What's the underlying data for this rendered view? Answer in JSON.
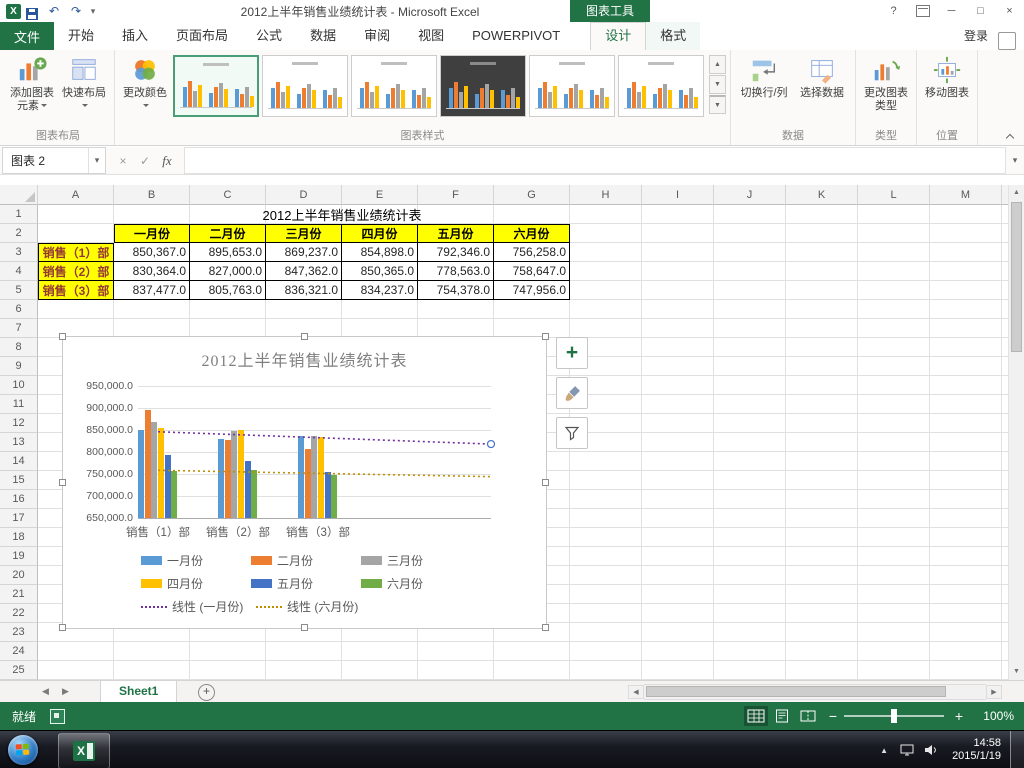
{
  "icons": {
    "dropdown": "▾",
    "up_arrow": "▲",
    "down_arrow": "▼",
    "left_arrow": "◀",
    "right_arrow": "▶",
    "close": "×",
    "minimize": "─",
    "maximize": "□",
    "help": "?",
    "undo": "↶",
    "redo": "↷",
    "cancel": "×",
    "check": "✓",
    "plus": "+",
    "minus": "−"
  },
  "titlebar": {
    "title": "2012上半年销售业绩统计表 - Microsoft Excel",
    "context_label": "图表工具"
  },
  "ribbon": {
    "file_tab": "文件",
    "tabs": [
      "开始",
      "插入",
      "页面布局",
      "公式",
      "数据",
      "审阅",
      "视图",
      "POWERPIVOT"
    ],
    "context_tabs": [
      {
        "label": "设计",
        "active": true
      },
      {
        "label": "格式",
        "active": false
      }
    ],
    "sign_in": "登录",
    "groups": {
      "layout": {
        "label": "图表布局",
        "add_element": "添加图表元素",
        "quick_layout": "快速布局"
      },
      "styles": {
        "label": "图表样式",
        "change_colors": "更改颜色",
        "items": [
          {
            "name": "样式 1",
            "selected": true,
            "dark": false
          },
          {
            "name": "样式 2",
            "selected": false,
            "dark": false
          },
          {
            "name": "样式 3",
            "selected": false,
            "dark": false
          },
          {
            "name": "样式 4",
            "selected": false,
            "dark": true
          },
          {
            "name": "样式 5",
            "selected": false,
            "dark": false
          },
          {
            "name": "样式 6",
            "selected": false,
            "dark": false
          }
        ]
      },
      "data": {
        "label": "数据",
        "switch_rc": "切换行/列",
        "select_data": "选择数据"
      },
      "type": {
        "label": "类型",
        "change_type": "更改图表类型"
      },
      "location": {
        "label": "位置",
        "move_chart": "移动图表"
      }
    }
  },
  "formula_bar": {
    "name_box": "图表 2",
    "fx": "fx"
  },
  "sheet": {
    "columns": [
      "A",
      "B",
      "C",
      "D",
      "E",
      "F",
      "G",
      "H",
      "I",
      "J",
      "K",
      "L",
      "M"
    ],
    "row_count": 25,
    "table": {
      "title": "2012上半年销售业绩统计表",
      "col_headers": [
        "一月份",
        "二月份",
        "三月份",
        "四月份",
        "五月份",
        "六月份"
      ],
      "row_headers": [
        "销售（1）部",
        "销售（2）部",
        "销售（3）部"
      ],
      "values": [
        [
          "850,367.0",
          "895,653.0",
          "869,237.0",
          "854,898.0",
          "792,346.0",
          "756,258.0"
        ],
        [
          "830,364.0",
          "827,000.0",
          "847,362.0",
          "850,365.0",
          "778,563.0",
          "758,647.0"
        ],
        [
          "837,477.0",
          "805,763.0",
          "836,321.0",
          "834,237.0",
          "754,378.0",
          "747,956.0"
        ]
      ]
    }
  },
  "chart_data": {
    "type": "bar",
    "title": "2012上半年销售业绩统计表",
    "categories": [
      "销售（1）部",
      "销售（2）部",
      "销售（3）部"
    ],
    "series": [
      {
        "name": "一月份",
        "color": "#5B9BD5",
        "values": [
          850367,
          830364,
          837477
        ]
      },
      {
        "name": "二月份",
        "color": "#ED7D31",
        "values": [
          895653,
          827000,
          805763
        ]
      },
      {
        "name": "三月份",
        "color": "#A5A5A5",
        "values": [
          869237,
          847362,
          836321
        ]
      },
      {
        "name": "四月份",
        "color": "#FFC000",
        "values": [
          854898,
          850365,
          834237
        ]
      },
      {
        "name": "五月份",
        "color": "#4472C4",
        "values": [
          792346,
          778563,
          754378
        ]
      },
      {
        "name": "六月份",
        "color": "#70AD47",
        "values": [
          756258,
          758647,
          747956
        ]
      }
    ],
    "ylim": [
      650000,
      950000
    ],
    "ytick_step": 50000,
    "ytick_labels": [
      "950,000.0",
      "900,000.0",
      "850,000.0",
      "800,000.0",
      "750,000.0",
      "700,000.0",
      "650,000.0"
    ],
    "grid": true,
    "legend_position": "bottom",
    "trendlines": [
      {
        "name": "线性 (一月份)",
        "color": "#7030A0",
        "start_value": 846000,
        "end_value": 818000,
        "endpoint_marker": true
      },
      {
        "name": "线性 (六月份)",
        "color": "#BF8F00",
        "start_value": 758400,
        "end_value": 744000,
        "endpoint_marker": false
      }
    ]
  },
  "sheet_tabs": {
    "active": "Sheet1"
  },
  "status_bar": {
    "mode": "就绪",
    "zoom": "100%"
  },
  "taskbar": {
    "time": "14:58",
    "date": "2015/1/19"
  }
}
